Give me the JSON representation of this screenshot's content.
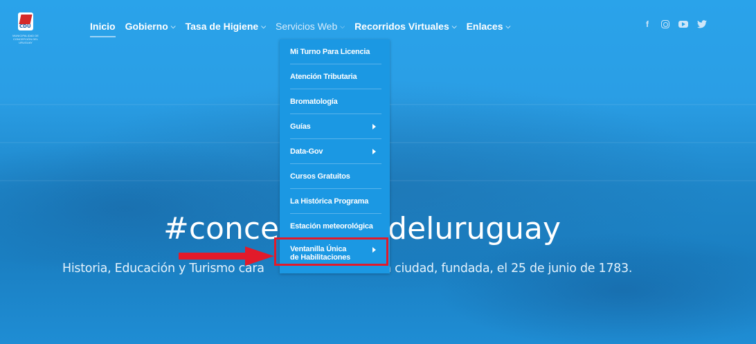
{
  "header": {
    "logo_text": "CDU",
    "logo_subtext": "MUNICIPALIDAD DE CONCEPCIÓN DEL URUGUAY"
  },
  "nav": {
    "items": [
      {
        "label": "Inicio",
        "has_dropdown": false
      },
      {
        "label": "Gobierno",
        "has_dropdown": true
      },
      {
        "label": "Tasa de Higiene",
        "has_dropdown": true
      },
      {
        "label": "Servicios Web",
        "has_dropdown": true
      },
      {
        "label": "Recorridos Virtuales",
        "has_dropdown": true
      },
      {
        "label": "Enlaces",
        "has_dropdown": true
      }
    ],
    "chevron": "⌵"
  },
  "social": {
    "icons": [
      "facebook-icon",
      "instagram-icon",
      "youtube-icon",
      "twitter-icon"
    ],
    "facebook_glyph": "f",
    "twitter_glyph": "🐦"
  },
  "dropdown": {
    "items": [
      {
        "label": "Mi Turno Para Licencia",
        "has_submenu": false
      },
      {
        "label": "Atención Tributaria",
        "has_submenu": false
      },
      {
        "label": "Bromatología",
        "has_submenu": false
      },
      {
        "label": "Guías",
        "has_submenu": true
      },
      {
        "label": "Data-Gov",
        "has_submenu": true
      },
      {
        "label": "Cursos Gratuitos",
        "has_submenu": false
      },
      {
        "label": "La Histórica Programa",
        "has_submenu": false
      },
      {
        "label": "Estación meteorológica",
        "has_submenu": false
      },
      {
        "label_line1": "Ventanilla Única",
        "label_line2": "de Habilitaciones",
        "has_submenu": true
      }
    ]
  },
  "hero": {
    "headline_left": "#conce",
    "headline_right": "deluruguay",
    "tagline_left": "Historia, Educación y Turismo cara",
    "tagline_right": "rica ciudad, fundada, el 25 de junio de 1783."
  },
  "colors": {
    "dropdown_bg": "#1b98e3",
    "highlight": "#e21a2a",
    "hero_blue": "#2aa3ea"
  }
}
